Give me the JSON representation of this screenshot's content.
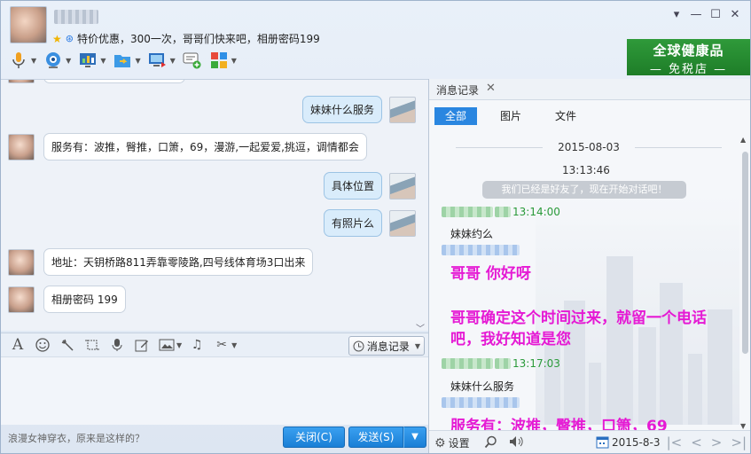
{
  "header": {
    "signature": "特价优惠，300一次，哥哥们快来吧，相册密码199"
  },
  "window_controls": {
    "menu": "▾",
    "minimize": "—",
    "maximize": "☐",
    "close": "✕"
  },
  "ad": {
    "line1": "全球健康品",
    "line2": "— 免税店 —"
  },
  "toolbar": {
    "icons": [
      "microphone-icon",
      "webcam-icon",
      "screen-share-icon",
      "file-transfer-icon",
      "remote-desktop-icon",
      "new-discussion-icon",
      "app-center-icon"
    ]
  },
  "chat": {
    "messages": [
      {
        "from": "me",
        "text": "妹妹什么服务"
      },
      {
        "from": "her",
        "text": "服务有：波推，臀推，口箫，69，漫游,一起爱爱,挑逗，调情都会"
      },
      {
        "from": "me",
        "text": "具体位置"
      },
      {
        "from": "me",
        "text": "有照片么"
      },
      {
        "from": "her",
        "text": "地址：天钥桥路811弄靠零陵路,四号线体育场3口出来"
      },
      {
        "from": "her",
        "text": "相册密码  199"
      }
    ]
  },
  "input_toolbar": {
    "icons": [
      "font-icon",
      "emoji-icon",
      "shake-icon",
      "screenshot-icon",
      "voice-icon",
      "edit-icon",
      "image-icon",
      "music-icon",
      "scissors-icon"
    ],
    "history_label": "消息记录"
  },
  "bottom": {
    "tip": "浪漫女神穿衣，原来是这样的？",
    "close_label": "关闭(C)",
    "send_label": "发送(S)"
  },
  "history": {
    "tab_label": "消息记录",
    "filters": [
      "全部",
      "图片",
      "文件"
    ],
    "date": "2015-08-03",
    "sys_time": "13:13:46",
    "sys_msg": "我们已经是好友了，现在开始对话吧！",
    "entries": [
      {
        "time": "13:14:00",
        "text": "妹妹约么",
        "style": "normal"
      },
      {
        "time": "",
        "text": "哥哥  你好呀",
        "style": "big"
      },
      {
        "time": "",
        "text": "哥哥确定这个时间过来，就留一个电话吧，我好知道是您",
        "style": "big"
      },
      {
        "time": "13:17:03",
        "text": "妹妹什么服务",
        "style": "normal"
      },
      {
        "time": "",
        "text": "服务有：波推，臀推，口箫，69",
        "style": "big"
      }
    ],
    "settings_label": "设置",
    "date_picker": "2015-8-3"
  },
  "colors": {
    "accent": "#2a86e0",
    "highlight_text": "#e51ad4",
    "time_green": "#2a9a3a"
  }
}
